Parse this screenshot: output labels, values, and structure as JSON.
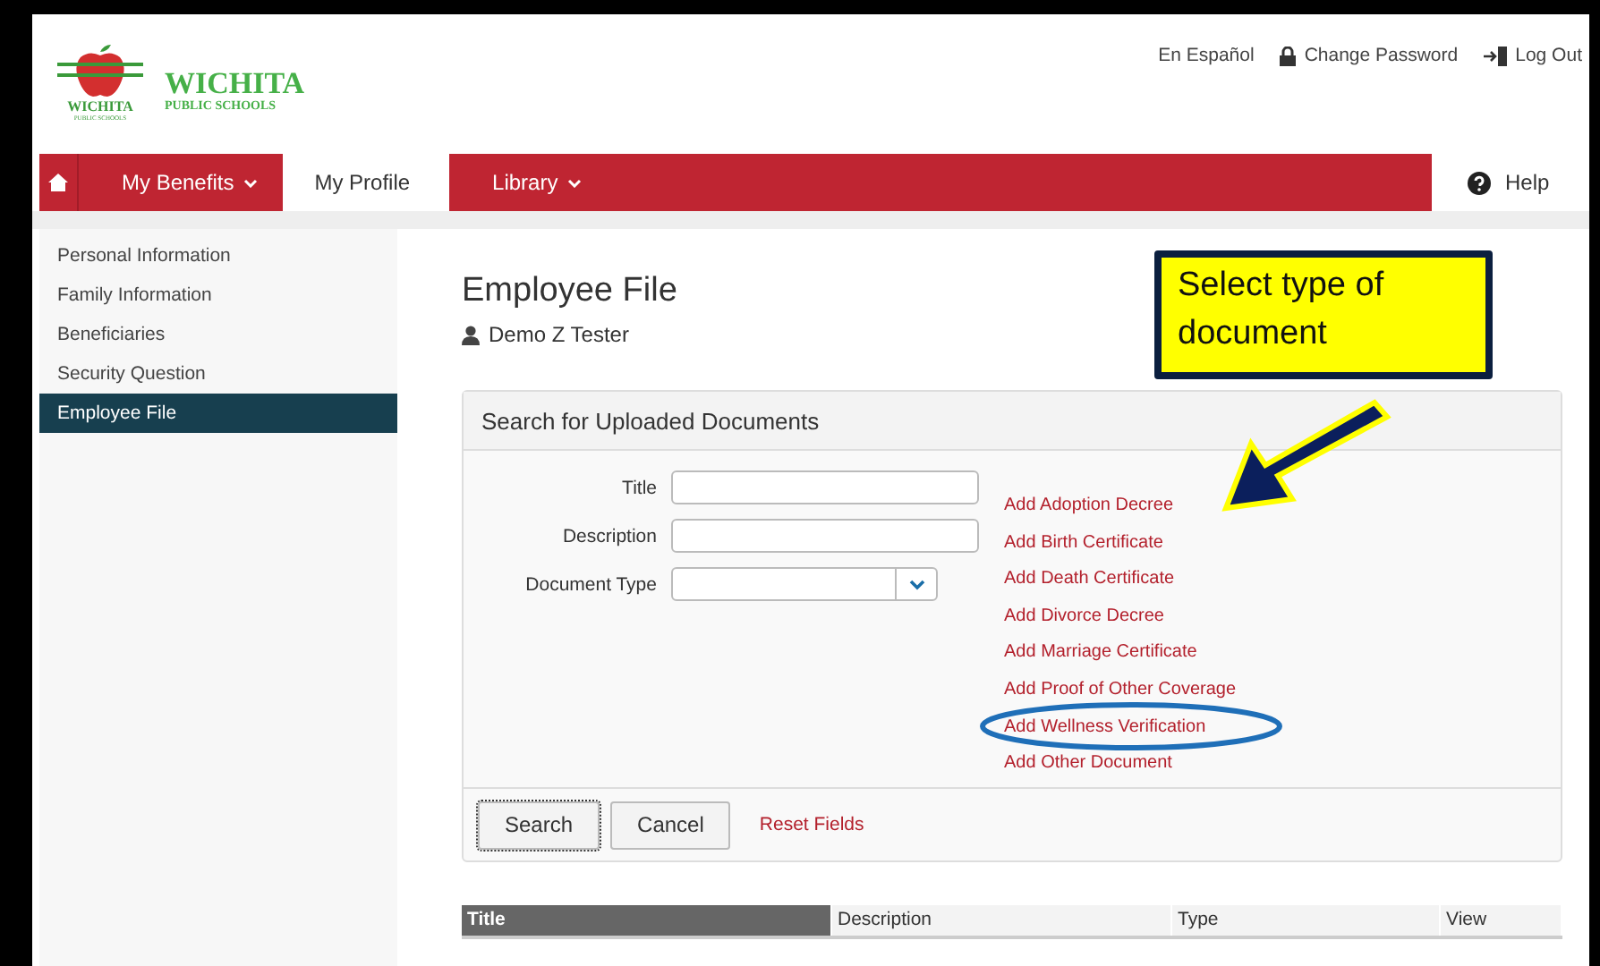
{
  "logo": {
    "title": "WICHITA",
    "subtitle": "PUBLIC SCHOOLS",
    "badge_title": "WICHITA",
    "badge_subtitle": "PUBLIC SCHOOLS"
  },
  "top_links": [
    {
      "label": "En Español",
      "kind": "plain"
    },
    {
      "label": "Change Password",
      "kind": "lock"
    },
    {
      "label": "Log Out",
      "kind": "logout"
    }
  ],
  "nav": {
    "tabs": [
      {
        "label": "My Benefits",
        "dropdown": true,
        "selected": false
      },
      {
        "label": "My Profile",
        "dropdown": false,
        "selected": true
      },
      {
        "label": "Library",
        "dropdown": true,
        "selected": false
      }
    ],
    "help": "Help"
  },
  "sidebar": {
    "items": [
      {
        "label": "Personal Information",
        "selected": false
      },
      {
        "label": "Family Information",
        "selected": false
      },
      {
        "label": "Beneficiaries",
        "selected": false
      },
      {
        "label": "Security Question",
        "selected": false
      },
      {
        "label": "Employee File",
        "selected": true
      }
    ]
  },
  "page": {
    "title": "Employee File",
    "user": "Demo Z Tester"
  },
  "search_panel": {
    "title": "Search for Uploaded Documents",
    "fields": [
      {
        "label": "Title",
        "kind": "text"
      },
      {
        "label": "Description",
        "kind": "text"
      },
      {
        "label": "Document Type",
        "kind": "select"
      }
    ],
    "add_links": [
      {
        "label": "Add Adoption Decree",
        "circled": false
      },
      {
        "label": "Add Birth Certificate",
        "circled": false
      },
      {
        "label": "Add Death Certificate",
        "circled": false
      },
      {
        "label": "Add Divorce Decree",
        "circled": false
      },
      {
        "label": "Add Marriage Certificate",
        "circled": false
      },
      {
        "label": "Add Proof of Other Coverage",
        "circled": false
      },
      {
        "label": "Add Wellness Verification",
        "circled": true
      },
      {
        "label": "Add Other Document",
        "circled": false
      }
    ],
    "buttons": [
      "Search",
      "Cancel"
    ],
    "reset": "Reset Fields"
  },
  "table": {
    "columns": [
      {
        "label": "Title",
        "selected": true
      },
      {
        "label": "Description",
        "selected": false
      },
      {
        "label": "Type",
        "selected": false
      },
      {
        "label": "View",
        "selected": false
      }
    ]
  },
  "annotation": {
    "callout": "Select type of document"
  }
}
